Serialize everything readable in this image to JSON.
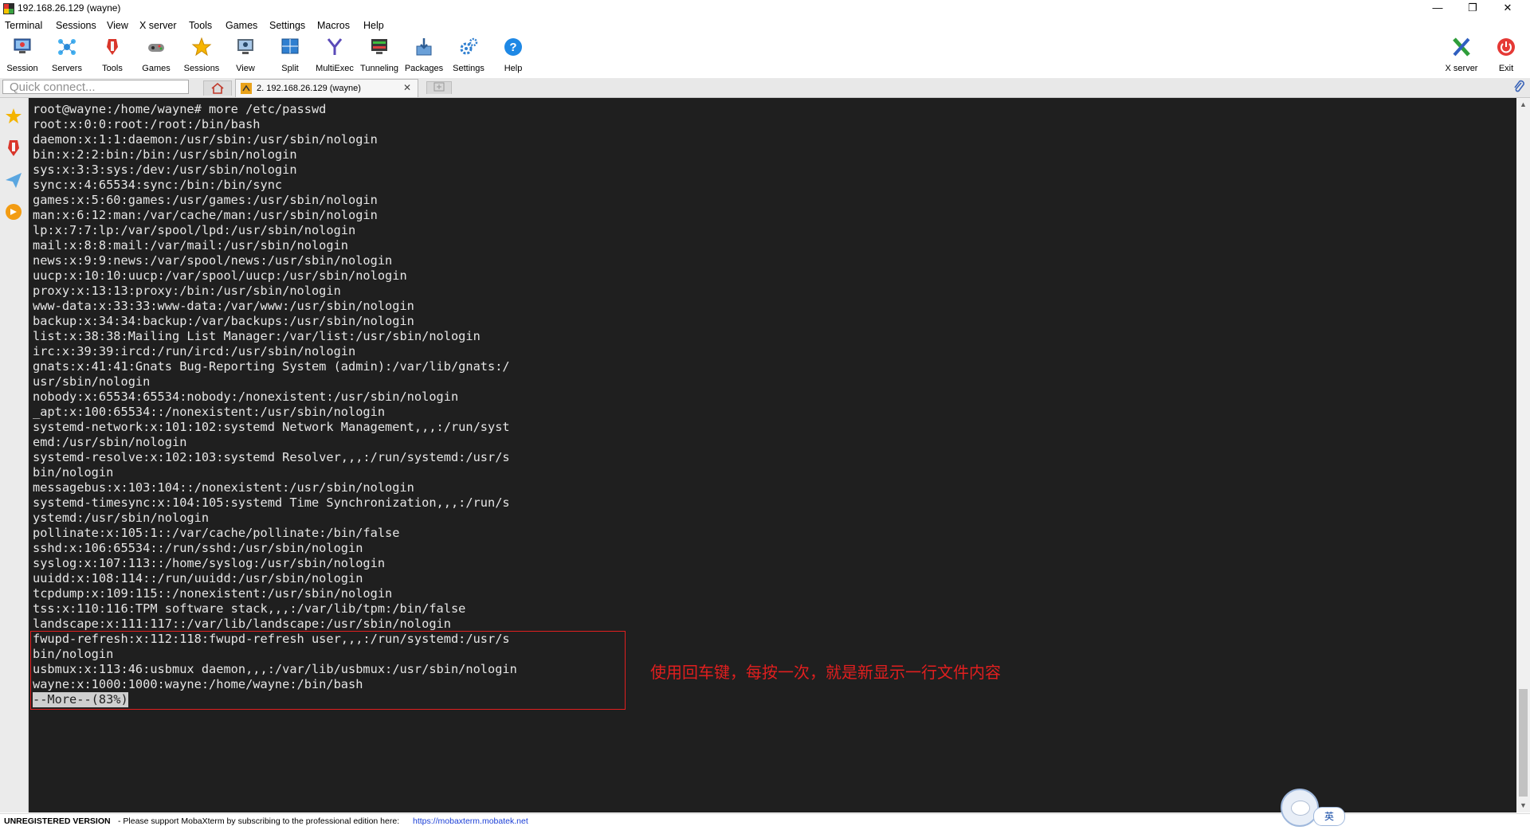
{
  "window": {
    "title": "192.168.26.129 (wayne)",
    "minimize": "—",
    "maximize": "❐",
    "close": "✕"
  },
  "menu": [
    "Terminal",
    "Sessions",
    "View",
    "X server",
    "Tools",
    "Games",
    "Settings",
    "Macros",
    "Help"
  ],
  "toolbar": {
    "session": "Session",
    "servers": "Servers",
    "tools": "Tools",
    "games": "Games",
    "sessions": "Sessions",
    "view": "View",
    "split": "Split",
    "multiexec": "MultiExec",
    "tunneling": "Tunneling",
    "packages": "Packages",
    "settings": "Settings",
    "help": "Help",
    "xserver": "X server",
    "exit": "Exit"
  },
  "tabs": {
    "quick_connect_placeholder": "Quick connect...",
    "active_tab": "2. 192.168.26.129 (wayne)",
    "close_glyph": "✕"
  },
  "terminal": {
    "lines": [
      "root@wayne:/home/wayne# more /etc/passwd",
      "root:x:0:0:root:/root:/bin/bash",
      "daemon:x:1:1:daemon:/usr/sbin:/usr/sbin/nologin",
      "bin:x:2:2:bin:/bin:/usr/sbin/nologin",
      "sys:x:3:3:sys:/dev:/usr/sbin/nologin",
      "sync:x:4:65534:sync:/bin:/bin/sync",
      "games:x:5:60:games:/usr/games:/usr/sbin/nologin",
      "man:x:6:12:man:/var/cache/man:/usr/sbin/nologin",
      "lp:x:7:7:lp:/var/spool/lpd:/usr/sbin/nologin",
      "mail:x:8:8:mail:/var/mail:/usr/sbin/nologin",
      "news:x:9:9:news:/var/spool/news:/usr/sbin/nologin",
      "uucp:x:10:10:uucp:/var/spool/uucp:/usr/sbin/nologin",
      "proxy:x:13:13:proxy:/bin:/usr/sbin/nologin",
      "www-data:x:33:33:www-data:/var/www:/usr/sbin/nologin",
      "backup:x:34:34:backup:/var/backups:/usr/sbin/nologin",
      "list:x:38:38:Mailing List Manager:/var/list:/usr/sbin/nologin",
      "irc:x:39:39:ircd:/run/ircd:/usr/sbin/nologin",
      "gnats:x:41:41:Gnats Bug-Reporting System (admin):/var/lib/gnats:/",
      "usr/sbin/nologin",
      "nobody:x:65534:65534:nobody:/nonexistent:/usr/sbin/nologin",
      "_apt:x:100:65534::/nonexistent:/usr/sbin/nologin",
      "systemd-network:x:101:102:systemd Network Management,,,:/run/syst",
      "emd:/usr/sbin/nologin",
      "systemd-resolve:x:102:103:systemd Resolver,,,:/run/systemd:/usr/s",
      "bin/nologin",
      "messagebus:x:103:104::/nonexistent:/usr/sbin/nologin",
      "systemd-timesync:x:104:105:systemd Time Synchronization,,,:/run/s",
      "ystemd:/usr/sbin/nologin",
      "pollinate:x:105:1::/var/cache/pollinate:/bin/false",
      "sshd:x:106:65534::/run/sshd:/usr/sbin/nologin",
      "syslog:x:107:113::/home/syslog:/usr/sbin/nologin",
      "uuidd:x:108:114::/run/uuidd:/usr/sbin/nologin",
      "tcpdump:x:109:115::/nonexistent:/usr/sbin/nologin",
      "tss:x:110:116:TPM software stack,,,:/var/lib/tpm:/bin/false",
      "landscape:x:111:117::/var/lib/landscape:/usr/sbin/nologin",
      "fwupd-refresh:x:112:118:fwupd-refresh user,,,:/run/systemd:/usr/s",
      "bin/nologin",
      "usbmux:x:113:46:usbmux daemon,,,:/var/lib/usbmux:/usr/sbin/nologin",
      "wayne:x:1000:1000:wayne:/home/wayne:/bin/bash"
    ],
    "more_prompt": "--More--(83%)",
    "annotation": "使用回车键，每按一次，就是新显示一行文件内容"
  },
  "statusbar": {
    "unregistered": "UNREGISTERED VERSION",
    "message": " -  Please support MobaXterm by subscribing to the professional edition here:",
    "link": "https://mobaxterm.mobatek.net"
  },
  "ime": {
    "lang": "英"
  },
  "colors": {
    "terminal_bg": "#1f1f1f",
    "terminal_fg": "#e6e6e6",
    "annotation_red": "#e01f1f",
    "link_blue": "#1a3ed6"
  }
}
